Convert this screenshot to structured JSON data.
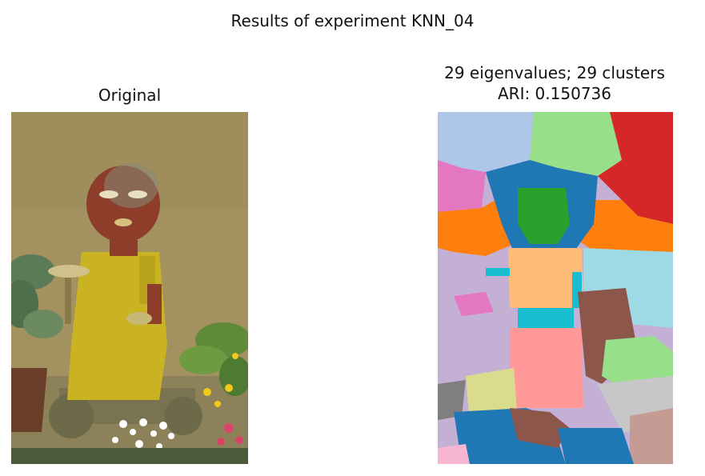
{
  "figure": {
    "suptitle": "Results of experiment KNN_04",
    "left_panel": {
      "title": "Original"
    },
    "right_panel": {
      "title_line1": "29 eigenvalues; 29 clusters",
      "title_line2": "ARI: 0.150736"
    }
  },
  "colors": {
    "wall": "#a3915f",
    "statue_yellow": "#c9b322",
    "face_red": "#8d3d2a",
    "seg_blue": "#1f77b4",
    "seg_orange": "#ff7f0e",
    "seg_green": "#2ca02c",
    "seg_red": "#d62728",
    "seg_lightblue": "#aec7e8",
    "seg_lightgreen": "#98df8a",
    "seg_pink": "#e377c2",
    "seg_lavender": "#c5b0d5",
    "seg_brown": "#8c564b",
    "seg_salmon": "#ff9896",
    "seg_peach": "#ffbb78",
    "seg_cyan": "#17becf",
    "seg_skyblue": "#9edae5",
    "seg_gray": "#c7c7c7",
    "seg_darkgray": "#7f7f7f",
    "seg_olive": "#dbdb8d",
    "seg_rose": "#c49c94",
    "seg_lightpink": "#f7b6d2"
  }
}
